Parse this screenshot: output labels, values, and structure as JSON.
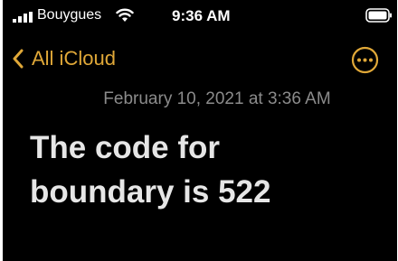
{
  "status_bar": {
    "carrier": "Bouygues",
    "time": "9:36 AM"
  },
  "nav": {
    "back_label": "All iCloud",
    "back_icon": "chevron-left-icon",
    "more_icon": "ellipsis-circle-icon"
  },
  "note": {
    "date": "February 10, 2021 at 3:36 AM",
    "line1": "The code for",
    "line2": "boundary is 522"
  },
  "colors": {
    "accent": "#e0a838",
    "background": "#000000",
    "date_text": "#8b8b8b",
    "body_text": "#e6e6e6"
  }
}
